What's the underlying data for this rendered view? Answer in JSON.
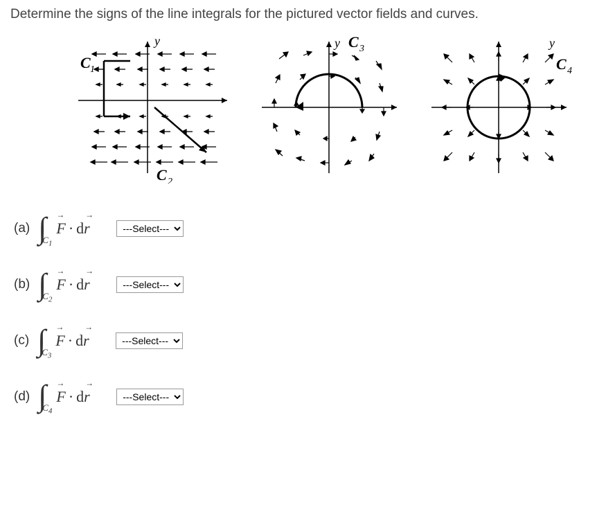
{
  "instruction": "Determine the signs of the line integrals for the pictured vector fields and curves.",
  "diagrams": {
    "d1": {
      "ylabel": "y",
      "c1_label": "C",
      "c1_sub": "1",
      "c2_label": "C",
      "c2_sub": "2"
    },
    "d2": {
      "ylabel": "y",
      "c3_label": "C",
      "c3_sub": "3"
    },
    "d3": {
      "ylabel": "y",
      "c4_label": "C",
      "c4_sub": "4"
    }
  },
  "questions": {
    "a": {
      "label": "(a)",
      "curve_sub": "1"
    },
    "b": {
      "label": "(b)",
      "curve_sub": "2"
    },
    "c": {
      "label": "(c)",
      "curve_sub": "3"
    },
    "d": {
      "label": "(d)",
      "curve_sub": "4"
    }
  },
  "select_placeholder": "---Select---",
  "integral_F": "F",
  "integral_d": "d",
  "integral_r": "r",
  "curve_C": "C"
}
